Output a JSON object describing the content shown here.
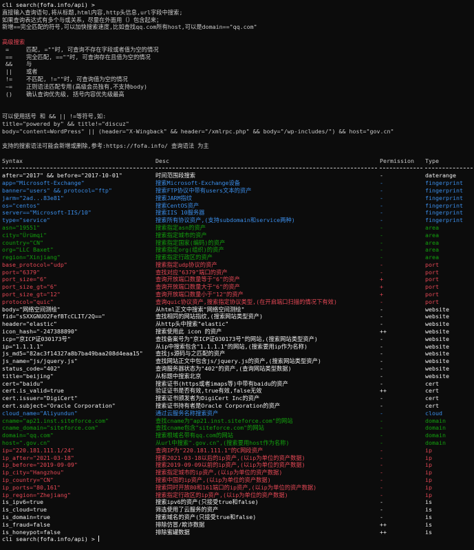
{
  "colors": {
    "background": "#0c0c0c",
    "text": "#cccccc",
    "white": "#f2f2f2",
    "red": "#e74856",
    "blue": "#3b8eea",
    "green": "#13a10e",
    "red_row": "#e74856"
  },
  "prompt_line": "cli search(fofa.info/api) >",
  "intro": [
    "直接输入查询语句,将从标题,html内容,http头信息,url字段中搜索;",
    "如果查询表达式有多个与或关系，尽量在外面用（）包含起来；",
    "新增==完全匹配的符号,可以加快搜索速度,比如查找qq.com所有host,可以是domain==\"qq.com\""
  ],
  "advanced_title": "高级搜索",
  "operators": [
    " =     匹配, =\"\"时, 可查询不存在字段或者值为空的情况",
    " ==    完全匹配, ==\"\"时, 可查询存在且值为空的情况",
    " &&    与",
    " ||    或者",
    " !=    不匹配, !=\"\"时, 可查询值为空的情况",
    " ~=    正则语法匹配专用(高级会员独有,不支持body)",
    " ()    确认查询优先级, 括号内容优先级最高"
  ],
  "examples": [
    "可以使用括号 和 && || !=等符号,如:",
    "title=\"powered by\" && title!=\"discuz\"",
    "body=\"content=WordPress\" || (header=\"X-Wingback\" && header=\"/xmlrpc.php\" && body=\"/wp-includes/\") && host=\"gov.cn\""
  ],
  "note": "支持的搜索语法可能会新增或删除,参考:https://fofa.info/ 查询语法 为主",
  "table": {
    "headers": [
      "Syntax",
      "Desc",
      "Permission",
      "Type"
    ],
    "rows": [
      {
        "syntax": "after=\"2017\" && before=\"2017-10-01\"",
        "desc": "时间范围段搜索",
        "perm": "-",
        "type": "daterange",
        "color": "white"
      },
      {
        "syntax": "app=\"Microsoft-Exchange\"",
        "desc": "搜索Microsoft-Exchange设备",
        "perm": "-",
        "type": "fingerprint",
        "color": "blue"
      },
      {
        "syntax": "banner=\"users\" && protocol=\"ftp\"",
        "desc": "搜索FTP协议中带有users文本的资产",
        "perm": "-",
        "type": "fingerprint",
        "color": "blue"
      },
      {
        "syntax": "jarm=\"2ad...83e81\"",
        "desc": "搜索JARM指纹",
        "perm": "-",
        "type": "fingerprint",
        "color": "blue"
      },
      {
        "syntax": "os=\"centos\"",
        "desc": "搜索CentOS资产",
        "perm": "-",
        "type": "fingerprint",
        "color": "blue"
      },
      {
        "syntax": "server==\"Microsoft-IIS/10\"",
        "desc": "搜索IIS 10服务器",
        "perm": "-",
        "type": "fingerprint",
        "color": "blue"
      },
      {
        "syntax": "type=\"service\"",
        "desc": "搜索所有协议资产,(支持subdomain和service两种)",
        "perm": "-",
        "type": "fingerprint",
        "color": "blue"
      },
      {
        "syntax": "asn=\"19551\"",
        "desc": "搜索指定asn的资产",
        "perm": "-",
        "type": "area",
        "color": "green"
      },
      {
        "syntax": "city=\"Ürümqi\"",
        "desc": "搜索指定城市的资产",
        "perm": "-",
        "type": "area",
        "color": "green"
      },
      {
        "syntax": "country=\"CN\"",
        "desc": "搜索指定国家(编码)的资产",
        "perm": "-",
        "type": "area",
        "color": "green"
      },
      {
        "syntax": "org=\"LLC Baxet\"",
        "desc": "搜索指定org(组织)的资产",
        "perm": "-",
        "type": "area",
        "color": "green"
      },
      {
        "syntax": "region=\"Xinjiang\"",
        "desc": "搜索指定行政区的资产",
        "perm": "-",
        "type": "area",
        "color": "green"
      },
      {
        "syntax": "base_protocol=\"udp\"",
        "desc": "搜索指定udp协议的资产",
        "perm": "-",
        "type": "port",
        "color": "red"
      },
      {
        "syntax": "port=\"6379\"",
        "desc": "查找对应\"6379\"端口的资产",
        "perm": "-",
        "type": "port",
        "color": "red"
      },
      {
        "syntax": "port_size=\"6\"",
        "desc": "查询开放端口数量等于\"6\"的资产",
        "perm": "+",
        "type": "port",
        "color": "red"
      },
      {
        "syntax": "port_size_gt=\"6\"",
        "desc": "查询开放端口数量大于\"6\"的资产",
        "perm": "+",
        "type": "port",
        "color": "red"
      },
      {
        "syntax": "port_size_gt=\"12\"",
        "desc": "查询开放端口数量小于\"12\"的资产",
        "perm": "+",
        "type": "port",
        "color": "red"
      },
      {
        "syntax": "protocol=\"quic\"",
        "desc": "查询quic协议资产,搜索指定协议类型,(在开启端口扫描的情况下有效)",
        "perm": "-",
        "type": "port",
        "color": "red"
      },
      {
        "syntax": "body=\"网络空间测绘\"",
        "desc": "从html正文中搜索\"网络空间测绘\"",
        "perm": "-",
        "type": "website",
        "color": "white"
      },
      {
        "syntax": "fid=\"sSXXGNUO2FefBTcCLIT/2Q==\"",
        "desc": "查找相同的网站指纹,(搜索网站类型资产)",
        "perm": "-",
        "type": "website",
        "color": "white"
      },
      {
        "syntax": "header=\"elastic\"",
        "desc": "从http头中搜索\"elastic\"",
        "perm": "-",
        "type": "website",
        "color": "white"
      },
      {
        "syntax": "icon_hash=\"-247388890\"",
        "desc": "搜索使用此 icon 的资产",
        "perm": "++",
        "type": "website",
        "color": "white"
      },
      {
        "syntax": "icp=\"京ICP证030173号\"",
        "desc": "查找备案号为\"京ICP证030173号\"的网站,(搜索网站类型资产)",
        "perm": "-",
        "type": "website",
        "color": "white"
      },
      {
        "syntax": "ip=\"1.1.1.1\"",
        "desc": "从ip中搜索包含\"1.1.1.1\"的网站,(搜索要用ip作为名称)",
        "perm": "-",
        "type": "website",
        "color": "white"
      },
      {
        "syntax": "js_md5=\"82ac3f14327a8b7ba49baa208d4eaa15\"",
        "desc": "查找js源码与之匹配的资产",
        "perm": "-",
        "type": "website",
        "color": "white"
      },
      {
        "syntax": "js_name=\"js/jquery.js\"",
        "desc": "查找网站正文中包含js/jquery.js的资产,(搜索网站类型资产)",
        "perm": "-",
        "type": "website",
        "color": "white"
      },
      {
        "syntax": "status_code=\"402\"",
        "desc": "查询服务器状态为\"402\"的资产,(查询网站类型数据)",
        "perm": "-",
        "type": "website",
        "color": "white"
      },
      {
        "syntax": "title=\"beijing\"",
        "desc": "从标题中搜索北京",
        "perm": "-",
        "type": "website",
        "color": "white"
      },
      {
        "syntax": "cert=\"baidu\"",
        "desc": "搜索证书(https或者imaps等)中带有baidu的资产",
        "perm": "-",
        "type": "cert",
        "color": "white"
      },
      {
        "syntax": "cert.is_valid=true",
        "desc": "验证证书是否有效,true有效,false无效",
        "perm": "++",
        "type": "cert",
        "color": "white"
      },
      {
        "syntax": "cert.issuer=\"DigiCert\"",
        "desc": "搜索证书颁发者为DigiCert Inc的资产",
        "perm": "-",
        "type": "cert",
        "color": "white"
      },
      {
        "syntax": "cert.subject=\"Oracle Corporation\"",
        "desc": "搜索证书持有者是Oracle Corporation的资产",
        "perm": "-",
        "type": "cert",
        "color": "white"
      },
      {
        "syntax": "cloud_name=\"Aliyundun\"",
        "desc": "通过云服务名称搜索资产",
        "perm": "-",
        "type": "cloud",
        "color": "blue"
      },
      {
        "syntax": "cname=\"ap21.inst.siteforce.com\"",
        "desc": "查找cname为\"ap21.inst.siteforce.com\"的网站",
        "perm": "-",
        "type": "domain",
        "color": "green"
      },
      {
        "syntax": "cname_domain=\"siteforce.com\"",
        "desc": "查找cname包含\"siteforce.com\"的网站",
        "perm": "-",
        "type": "domain",
        "color": "green"
      },
      {
        "syntax": "domain=\"qq.com\"",
        "desc": "搜索根域名带有qq.com的网站",
        "perm": "-",
        "type": "domain",
        "color": "green"
      },
      {
        "syntax": "host=\".gov.cn\"",
        "desc": "从url中搜索\".gov.cn\",(搜索要用host作为名称)",
        "perm": "-",
        "type": "domain",
        "color": "green"
      },
      {
        "syntax": "ip=\"220.181.111.1/24\"",
        "desc": "查询IP为\"220.181.111.1\"的C网段资产",
        "perm": "-",
        "type": "ip",
        "color": "red"
      },
      {
        "syntax": "ip_after=\"2021-03-18\"",
        "desc": "搜索2021-03-18以后的ip资产,(以ip为单位的资产数据)",
        "perm": "-",
        "type": "ip",
        "color": "red"
      },
      {
        "syntax": "ip_before=\"2019-09-09\"",
        "desc": "搜索2019-09-09以前的ip资产,(以ip为单位的资产数据)",
        "perm": "-",
        "type": "ip",
        "color": "red"
      },
      {
        "syntax": "ip_city=\"Hangzhou\"",
        "desc": "搜索指定城市的ip资产,(以ip为单位的资产数据)",
        "perm": "-",
        "type": "ip",
        "color": "red"
      },
      {
        "syntax": "ip_country=\"CN\"",
        "desc": "搜索中国的ip资产,(以ip为单位的资产数据)",
        "perm": "-",
        "type": "ip",
        "color": "red"
      },
      {
        "syntax": "ip_ports=\"80,161\"",
        "desc": "搜索同时开放80和161端口的ip资产,(以ip为单位的资产数据)",
        "perm": "-",
        "type": "ip",
        "color": "red"
      },
      {
        "syntax": "ip_region=\"Zhejiang\"",
        "desc": "搜索指定行政区的ip资产,(以ip为单位的资产数据)",
        "perm": "-",
        "type": "ip",
        "color": "red"
      },
      {
        "syntax": "is_ipv6=true",
        "desc": "搜索ipv6的资产(只接受true和false)",
        "perm": "-",
        "type": "is",
        "color": "white"
      },
      {
        "syntax": "is_cloud=true",
        "desc": "筛选使用了云服务的资产",
        "perm": "-",
        "type": "is",
        "color": "white"
      },
      {
        "syntax": "is_domain=true",
        "desc": "搜索域名的资产(只接受true和false)",
        "perm": "-",
        "type": "is",
        "color": "white"
      },
      {
        "syntax": "is_fraud=false",
        "desc": "排除仿冒/欺诈数据",
        "perm": "++",
        "type": "is",
        "color": "white"
      },
      {
        "syntax": "is_honeypot=false",
        "desc": "排除蜜罐数据",
        "perm": "++",
        "type": "is",
        "color": "white"
      }
    ]
  }
}
